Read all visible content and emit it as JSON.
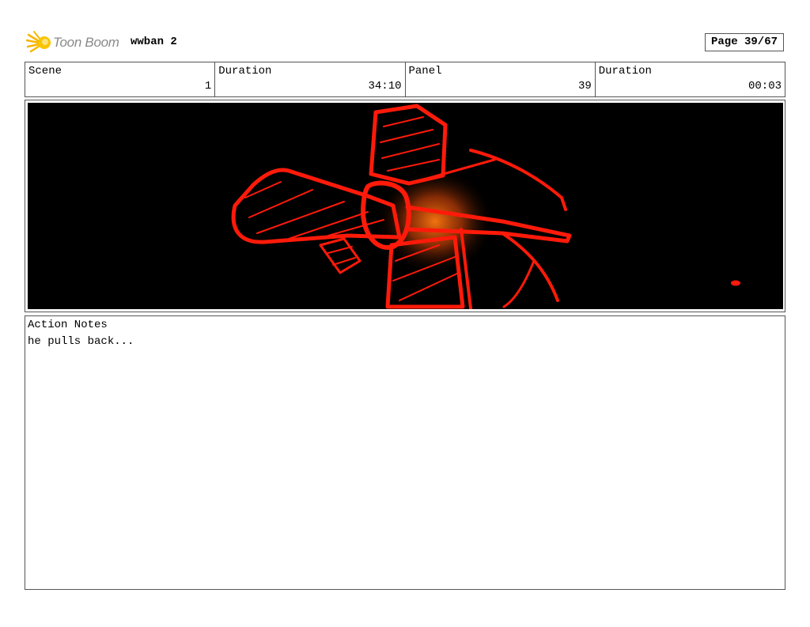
{
  "header": {
    "logo_text": "Toon Boom",
    "project_title": "wwban 2",
    "page_label": "Page 39/67"
  },
  "info": {
    "scene_label": "Scene",
    "scene_value": "1",
    "duration_label": "Duration",
    "duration_value": "34:10",
    "panel_label": "Panel",
    "panel_value": "39",
    "panel_duration_label": "Duration",
    "panel_duration_value": "00:03"
  },
  "frame": {
    "background_color": "#000000",
    "sketch_color": "#ff1a0a",
    "glow_color": "#ff7a10"
  },
  "notes": {
    "label": "Action Notes",
    "text": "he pulls back..."
  }
}
